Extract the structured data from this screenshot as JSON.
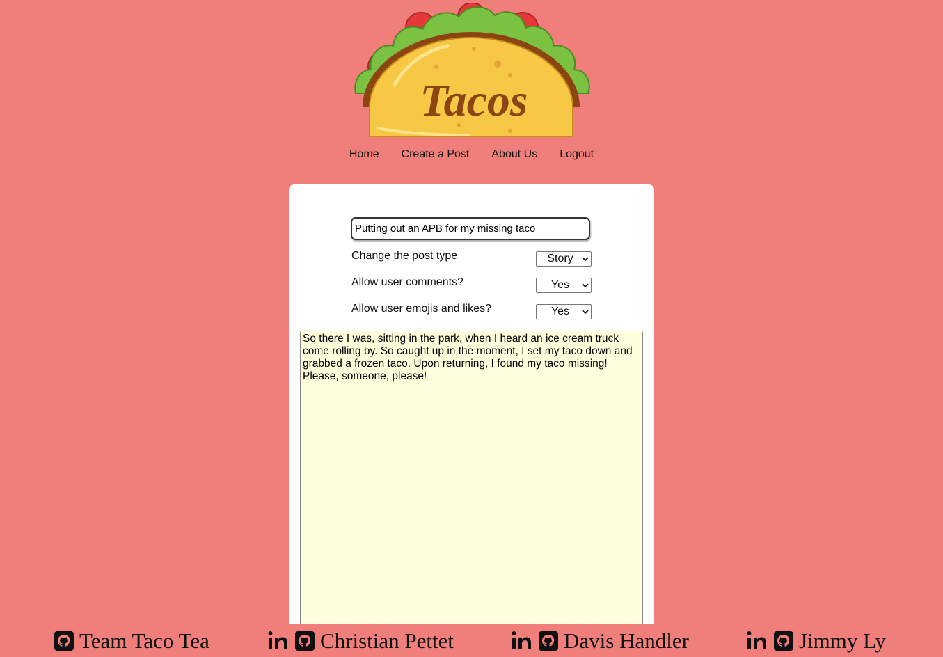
{
  "brand": {
    "logo_text": "Tacos"
  },
  "nav": [
    {
      "label": "Home"
    },
    {
      "label": "Create a Post"
    },
    {
      "label": "About Us"
    },
    {
      "label": "Logout"
    }
  ],
  "post": {
    "title_value": "Putting out an APB for my missing taco",
    "options": [
      {
        "label": "Change the post type",
        "value": "Story"
      },
      {
        "label": "Allow user comments?",
        "value": "Yes"
      },
      {
        "label": "Allow user emojis and likes?",
        "value": "Yes"
      }
    ],
    "body_value": "So there I was, sitting in the park, when I heard an ice cream truck come rolling by. So caught up in the moment, I set my taco down and grabbed a frozen taco. Upon returning, I found my taco missing! Please, someone, please!"
  },
  "footer": {
    "credits": [
      {
        "name": "Team Taco Tea",
        "icons": [
          "github-icon"
        ]
      },
      {
        "name": "Christian Pettet",
        "icons": [
          "linkedin-icon",
          "github-icon"
        ]
      },
      {
        "name": "Davis Handler",
        "icons": [
          "linkedin-icon",
          "github-icon"
        ]
      },
      {
        "name": "Jimmy Ly",
        "icons": [
          "linkedin-icon",
          "github-icon"
        ]
      }
    ]
  },
  "colors": {
    "background": "#f07f7c",
    "card": "#ffffff",
    "textarea_bg": "#ffffde",
    "taco_shell": "#f7c845",
    "taco_text": "#8b4513",
    "lettuce": "#7cc242",
    "tomato": "#e8373a"
  }
}
